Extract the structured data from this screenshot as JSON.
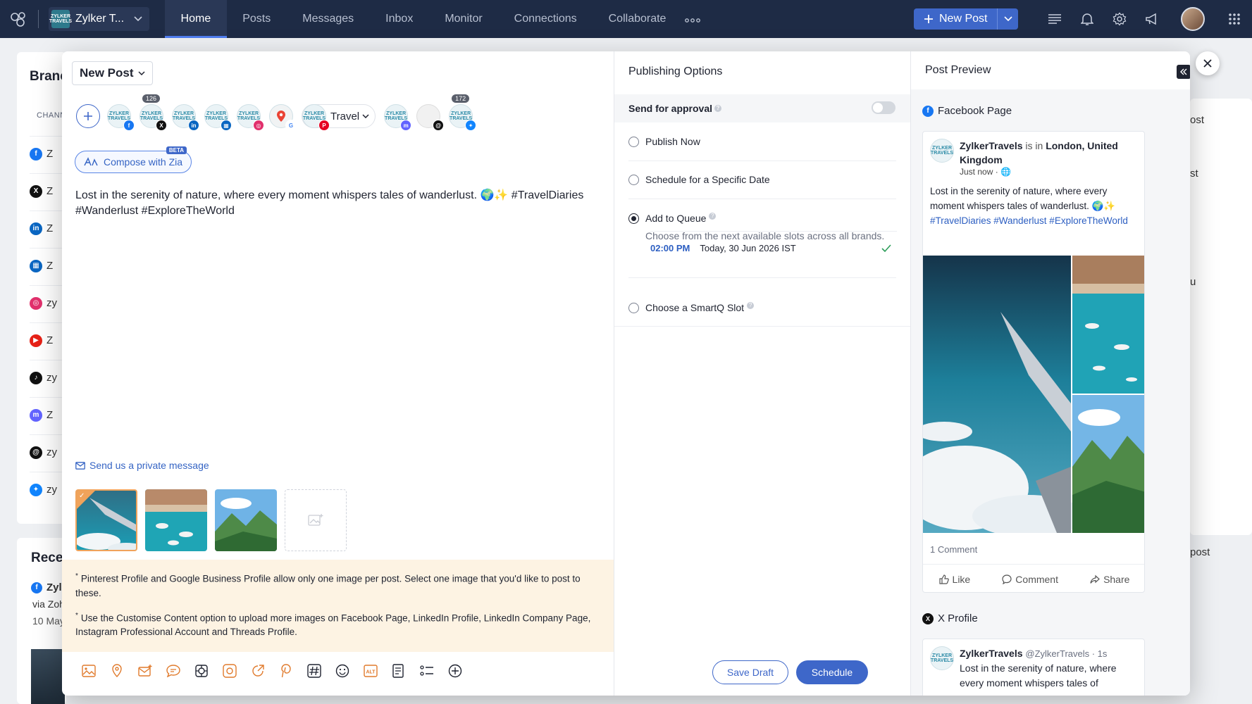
{
  "topbar": {
    "brand_name": "Zylker T...",
    "brand_logo_text": "ZYLKER TRAVELS",
    "nav": [
      "Home",
      "Posts",
      "Messages",
      "Inbox",
      "Monitor",
      "Connections",
      "Collaborate"
    ],
    "active_tab": "Home",
    "new_post_label": "New Post"
  },
  "background": {
    "left_title": "Branc",
    "channel_header": "CHANN",
    "row_labels": [
      "Z",
      "Z",
      "Z",
      "Z",
      "zy",
      "Z",
      "zy",
      "Z",
      "zy",
      "zy"
    ],
    "recent_title": "Rece",
    "recent_line1": "Zyl",
    "recent_line2": "via Zoh",
    "recent_line3": "10 May",
    "right_texts": [
      "ost",
      "st",
      "u",
      "post"
    ]
  },
  "compose": {
    "new_post_dropdown": "New Post",
    "profile_count_x": "126",
    "profile_count_bluesky": "172",
    "travel_group_label": "Travel",
    "compose_with_zia": "Compose with Zia",
    "zia_badge": "BETA",
    "post_text": "Lost in the serenity of nature, where every moment whispers tales of wanderlust. 🌍✨ #TravelDiaries #Wanderlust #ExploreTheWorld",
    "private_message": "Send us a private message",
    "notices": [
      "Pinterest Profile and Google Business Profile allow only one image per post. Select one image that you'd like to post to these.",
      "Use the Customise Content option to upload more images on Facebook Page, LinkedIn Profile, LinkedIn Company Page, Instagram Professional Account and Threads Profile."
    ],
    "notice_bullet": "*"
  },
  "publishing": {
    "title": "Publishing Options",
    "approval_label": "Send for approval",
    "approval_enabled": false,
    "options": {
      "publish_now": "Publish Now",
      "schedule_specific": "Schedule for a Specific Date",
      "add_to_queue": "Add to Queue",
      "queue_hint": "Choose from the next available slots across all brands.",
      "smartq": "Choose a SmartQ Slot"
    },
    "selected_option": "add_to_queue",
    "slot_time": "02:00 PM",
    "slot_date": "Today, 30 Jun 2026 IST"
  },
  "preview": {
    "title": "Post Preview",
    "facebook_label": "Facebook Page",
    "fb_name": "ZylkerTravels",
    "fb_is_in": "is in",
    "fb_location": "London, United Kingdom",
    "fb_time": "Just now ·",
    "fb_text_main": "Lost in the serenity of nature, where every moment whispers tales of wanderlust. 🌍✨",
    "fb_text_tags": "#TravelDiaries #Wanderlust #ExploreTheWorld",
    "fb_comments": "1 Comment",
    "fb_like": "Like",
    "fb_comment": "Comment",
    "fb_share": "Share",
    "x_label": "X Profile",
    "x_name": "ZylkerTravels",
    "x_handle": "@ZylkerTravels · 1s",
    "x_text": "Lost in the serenity of nature, where every moment whispers tales of"
  },
  "footer": {
    "save_draft": "Save Draft",
    "schedule": "Schedule"
  },
  "colors": {
    "nav_bg": "#1e2b45",
    "accent": "#3e67c9",
    "notice_bg": "#fdf3e3",
    "tool_icon": "#e07a2c"
  }
}
